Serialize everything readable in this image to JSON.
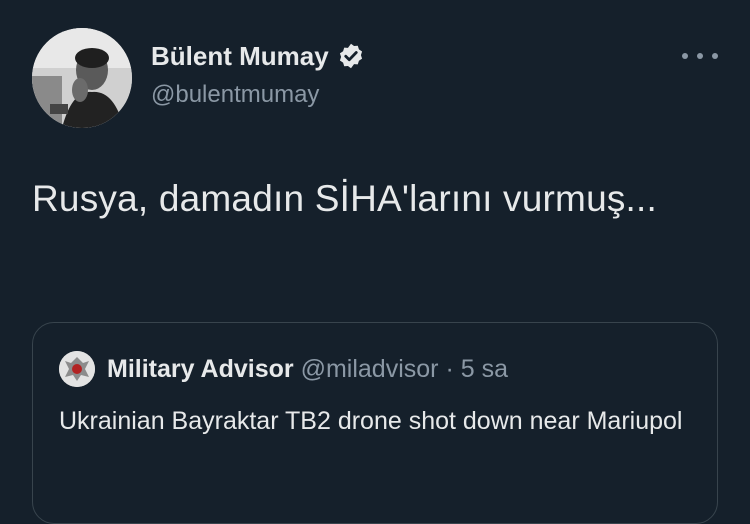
{
  "author": {
    "display_name": "Bülent Mumay",
    "handle": "@bulentmumay",
    "avatar_icon": "user-avatar-photo",
    "verified_icon": "verified-badge-icon"
  },
  "tweet": {
    "text": "Rusya, damadın SİHA'larını vurmuş..."
  },
  "quote": {
    "display_name": "Military Advisor",
    "handle": "@miladvisor",
    "separator": "·",
    "time": "5 sa",
    "text": "Ukrainian Bayraktar TB2 drone shot down near Mariupol"
  },
  "menu": {
    "icon": "more-options-icon"
  },
  "colors": {
    "background": "#15202b",
    "primary_text": "#e7e9ea",
    "secondary_text": "#8b98a5",
    "border": "#38444d"
  }
}
